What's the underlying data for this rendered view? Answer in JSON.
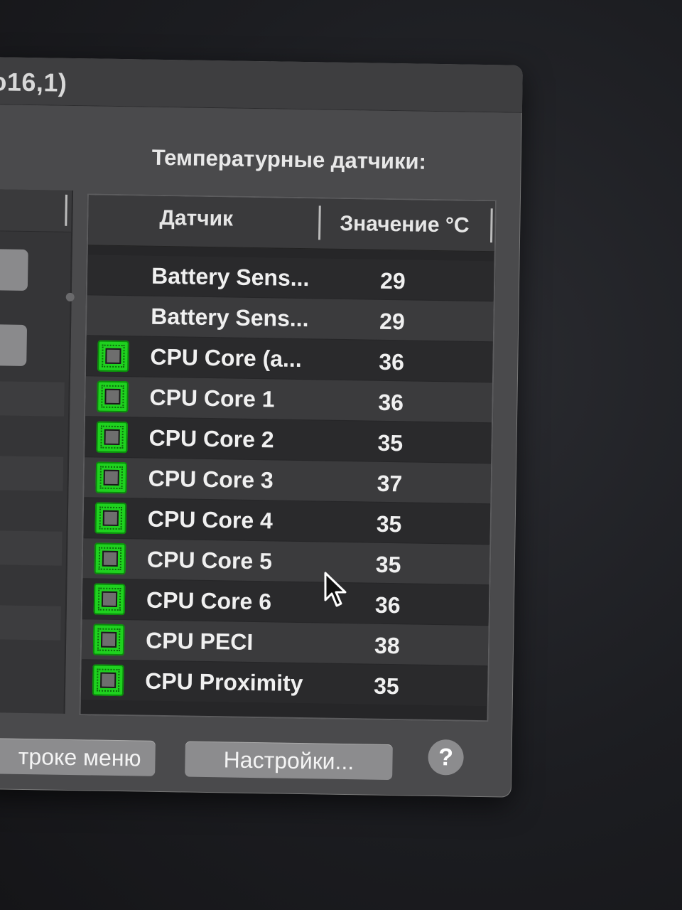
{
  "window": {
    "title_fragment": "o16,1)",
    "section_title": "Температурные датчики:"
  },
  "table": {
    "columns": {
      "sensor": "Датчик",
      "value": "Значение °C"
    },
    "rows": [
      {
        "name": "Battery Sens...",
        "value": "29",
        "icon": ""
      },
      {
        "name": "Battery Sens...",
        "value": "29",
        "icon": ""
      },
      {
        "name": "CPU Core (a...",
        "value": "36",
        "icon": "cpu-chip-icon"
      },
      {
        "name": "CPU Core 1",
        "value": "36",
        "icon": "cpu-chip-icon"
      },
      {
        "name": "CPU Core 2",
        "value": "35",
        "icon": "cpu-chip-icon"
      },
      {
        "name": "CPU Core 3",
        "value": "37",
        "icon": "cpu-chip-icon"
      },
      {
        "name": "CPU Core 4",
        "value": "35",
        "icon": "cpu-chip-icon"
      },
      {
        "name": "CPU Core 5",
        "value": "35",
        "icon": "cpu-chip-icon"
      },
      {
        "name": "CPU Core 6",
        "value": "36",
        "icon": "cpu-chip-icon"
      },
      {
        "name": "CPU PECI",
        "value": "38",
        "icon": "cpu-chip-icon"
      },
      {
        "name": "CPU Proximity",
        "value": "35",
        "icon": "cpu-chip-icon"
      }
    ]
  },
  "buttons": {
    "menu_bar": "троке меню",
    "settings": "Настройки...",
    "help": "?"
  },
  "colors": {
    "window_bg": "#4a4a4c",
    "row_dark": "#2a2a2c",
    "row_light": "#3b3b3d",
    "chip_green": "#1fd11f"
  }
}
